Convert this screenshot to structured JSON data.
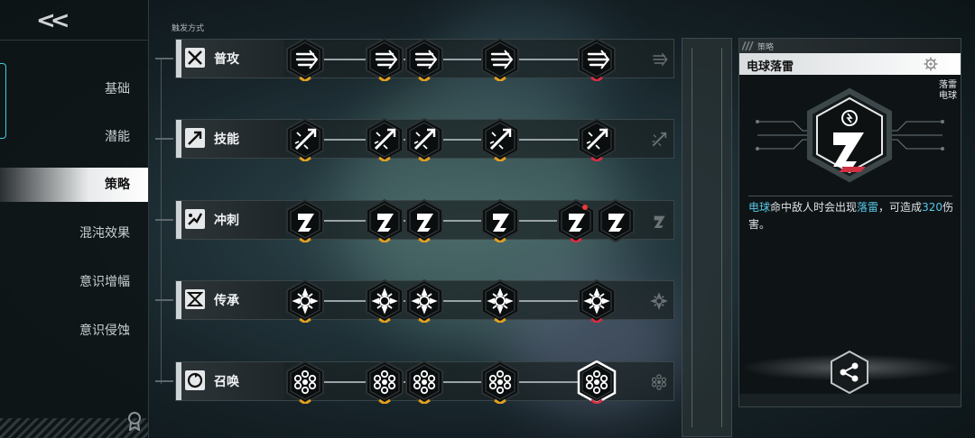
{
  "sidebar": {
    "back_label": "<<",
    "items": [
      {
        "label": "基础"
      },
      {
        "label": "潜能"
      },
      {
        "label": "策略"
      },
      {
        "label": "混沌效果"
      },
      {
        "label": "意识增幅"
      },
      {
        "label": "意识侵蚀"
      }
    ],
    "active_index": 2
  },
  "main": {
    "trigger_label": "触发方式",
    "rows": [
      {
        "name": "普攻",
        "icon": "x-blades-icon",
        "nodes": 5
      },
      {
        "name": "技能",
        "icon": "arrow-burst-icon",
        "nodes": 5
      },
      {
        "name": "冲刺",
        "icon": "dash-icon",
        "nodes": 6
      },
      {
        "name": "传承",
        "icon": "hourglass-icon",
        "nodes": 5
      },
      {
        "name": "召唤",
        "icon": "summon-icon",
        "nodes": 5
      }
    ]
  },
  "detail": {
    "tab_label": "策略",
    "title": "电球落雷",
    "side_label": "落雷电球",
    "desc_part1": "电球",
    "desc_part2": "命中敌人时会出现",
    "desc_part3": "落雷",
    "desc_part4": "，可造成",
    "desc_part5": "320",
    "desc_part6": "伤害。"
  },
  "colors": {
    "accent_cyan": "#3ad0e0",
    "highlight_blue": "#55c8e8",
    "level_gold": "#e0a020",
    "level_red": "#d03040"
  }
}
